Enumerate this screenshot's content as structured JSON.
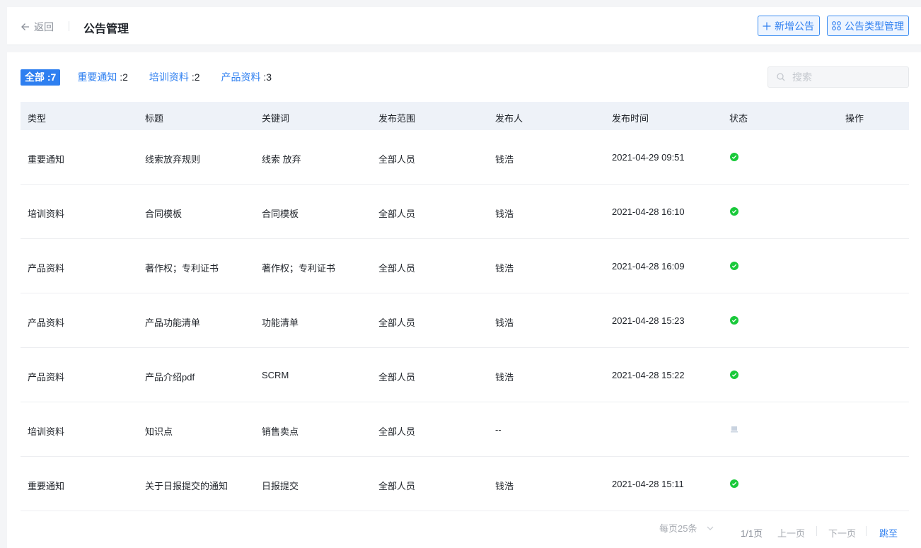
{
  "header": {
    "back_label": "返回",
    "title": "公告管理",
    "add_button": "新增公告",
    "type_button": "公告类型管理"
  },
  "filters": [
    {
      "label": "全部",
      "count": ":7",
      "active": true
    },
    {
      "label": "重要通知",
      "count": ":2",
      "active": false
    },
    {
      "label": "培训资料",
      "count": ":2",
      "active": false
    },
    {
      "label": "产品资料",
      "count": ":3",
      "active": false
    }
  ],
  "search": {
    "placeholder": "搜索",
    "value": ""
  },
  "table": {
    "columns": [
      "类型",
      "标题",
      "关键词",
      "发布范围",
      "发布人",
      "发布时间",
      "状态",
      "操作"
    ],
    "rows": [
      {
        "type": "重要通知",
        "title": "线索放弃规则",
        "keywords": "线索 放弃",
        "scope": "全部人员",
        "publisher": "钱浩",
        "time": "2021-04-29 09:51",
        "status": "published"
      },
      {
        "type": "培训资料",
        "title": "合同模板",
        "keywords": "合同模板",
        "scope": "全部人员",
        "publisher": "钱浩",
        "time": "2021-04-28 16:10",
        "status": "published"
      },
      {
        "type": "产品资料",
        "title": "著作权；专利证书",
        "keywords": "著作权；专利证书",
        "scope": "全部人员",
        "publisher": "钱浩",
        "time": "2021-04-28 16:09",
        "status": "published"
      },
      {
        "type": "产品资料",
        "title": "产品功能清单",
        "keywords": "功能清单",
        "scope": "全部人员",
        "publisher": "钱浩",
        "time": "2021-04-28 15:23",
        "status": "published"
      },
      {
        "type": "产品资料",
        "title": "产品介绍pdf",
        "keywords": "SCRM",
        "scope": "全部人员",
        "publisher": "钱浩",
        "time": "2021-04-28 15:22",
        "status": "published"
      },
      {
        "type": "培训资料",
        "title": "知识点",
        "keywords": "销售卖点",
        "scope": "全部人员",
        "publisher": "--",
        "time": "",
        "status": "draft"
      },
      {
        "type": "重要通知",
        "title": "关于日报提交的通知",
        "keywords": "日报提交",
        "scope": "全部人员",
        "publisher": "钱浩",
        "time": "2021-04-28 15:11",
        "status": "published"
      }
    ]
  },
  "pagination": {
    "page_size": "每页25条",
    "page_count": "1/1页",
    "prev": "上一页",
    "next": "下一页",
    "jump": "跳至"
  },
  "colors": {
    "accent": "#2e7ff0",
    "status_ok": "#19c93a",
    "header_bg": "#eef2f8"
  },
  "icons": {
    "back": "arrow-left-icon",
    "add": "plus-icon",
    "type": "grid-icon",
    "search": "search-icon",
    "published": "check-circle-icon",
    "draft": "draft-icon",
    "dropdown": "chevron-down-icon"
  }
}
